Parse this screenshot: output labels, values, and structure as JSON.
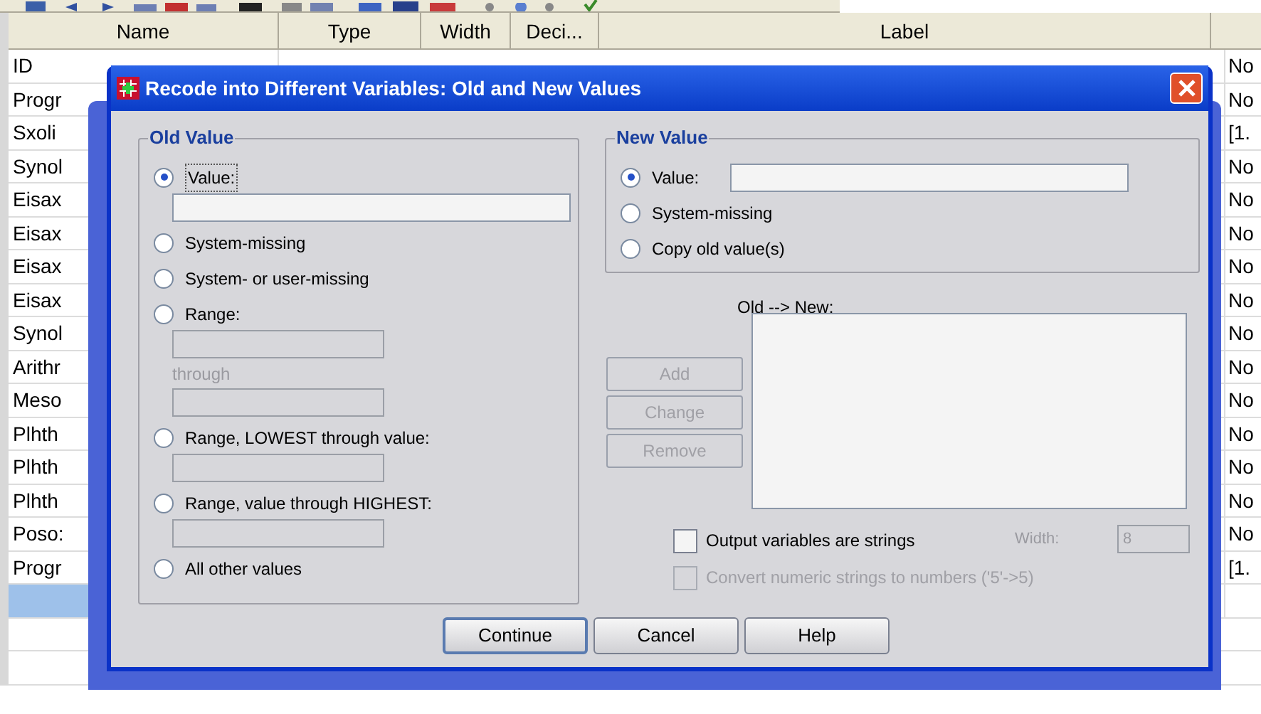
{
  "grid": {
    "columns": [
      "Name",
      "Type",
      "Width",
      "Deci...",
      "Label"
    ],
    "rows": [
      {
        "name": "ID",
        "column_6": "No",
        "selected": false
      },
      {
        "name": "Progr",
        "column_6": "No",
        "selected": false
      },
      {
        "name": "Sxoli",
        "column_6": "[1.",
        "selected": false
      },
      {
        "name": "Synol",
        "column_6": "No",
        "selected": false
      },
      {
        "name": "Eisax",
        "column_6": "No",
        "selected": false
      },
      {
        "name": "Eisax",
        "column_6": "No",
        "selected": false
      },
      {
        "name": "Eisax",
        "column_6": "No",
        "selected": false
      },
      {
        "name": "Eisax",
        "column_6": "No",
        "selected": false
      },
      {
        "name": "Synol",
        "column_6": "No",
        "selected": false
      },
      {
        "name": "Arithr",
        "column_6": "No",
        "selected": false
      },
      {
        "name": "Meso",
        "column_6": "No",
        "selected": false
      },
      {
        "name": "Plhth",
        "column_6": "No",
        "selected": false
      },
      {
        "name": "Plhth",
        "column_6": "No",
        "selected": false
      },
      {
        "name": "Plhth",
        "column_6": "No",
        "selected": false
      },
      {
        "name": "Poso:",
        "column_6": "No",
        "selected": false
      },
      {
        "name": "Progr",
        "column_6": "[1.",
        "selected": false
      },
      {
        "selected": true
      }
    ]
  },
  "dialog": {
    "title": "Recode into Different Variables: Old and New Values",
    "old_value": {
      "legend": "Old Value",
      "options": [
        {
          "kind": "field",
          "label": "Value:",
          "selected": true,
          "field_disabled": false
        },
        {
          "kind": "plain",
          "label": "System-missing",
          "selected": false
        },
        {
          "kind": "plain",
          "label": "System- or user-missing",
          "selected": false
        },
        {
          "kind": "range",
          "label": "Range:",
          "selected": false,
          "field_disabled": true,
          "through": "through"
        },
        {
          "kind": "field",
          "label": "Range, LOWEST through value:",
          "selected": false,
          "field_disabled": true
        },
        {
          "kind": "field",
          "label": "Range, value through HIGHEST:",
          "selected": false,
          "field_disabled": true
        },
        {
          "kind": "plain",
          "label": "All other values",
          "selected": false
        }
      ]
    },
    "new_value": {
      "legend": "New Value",
      "options": [
        {
          "kind": "inline",
          "label": "Value:",
          "selected": true,
          "field_disabled": false
        },
        {
          "kind": "plain",
          "label": "System-missing",
          "selected": false
        },
        {
          "kind": "plain",
          "label": "Copy old value(s)",
          "selected": false
        }
      ]
    },
    "list_label": "Old --> New:",
    "list_buttons": [
      {
        "label": "Add",
        "disabled": true
      },
      {
        "label": "Change",
        "disabled": true
      },
      {
        "label": "Remove",
        "disabled": true
      }
    ],
    "checkboxes": [
      {
        "label": "Output variables are strings",
        "checked": false,
        "disabled": false
      },
      {
        "label": "Convert numeric strings to numbers ('5'->5)",
        "checked": false,
        "disabled": true
      }
    ],
    "width": {
      "label": "Width:",
      "value": "8",
      "disabled": true
    },
    "buttons": [
      {
        "label": "Continue",
        "default": true
      },
      {
        "label": "Cancel",
        "default": false
      },
      {
        "label": "Help",
        "default": false
      }
    ]
  }
}
